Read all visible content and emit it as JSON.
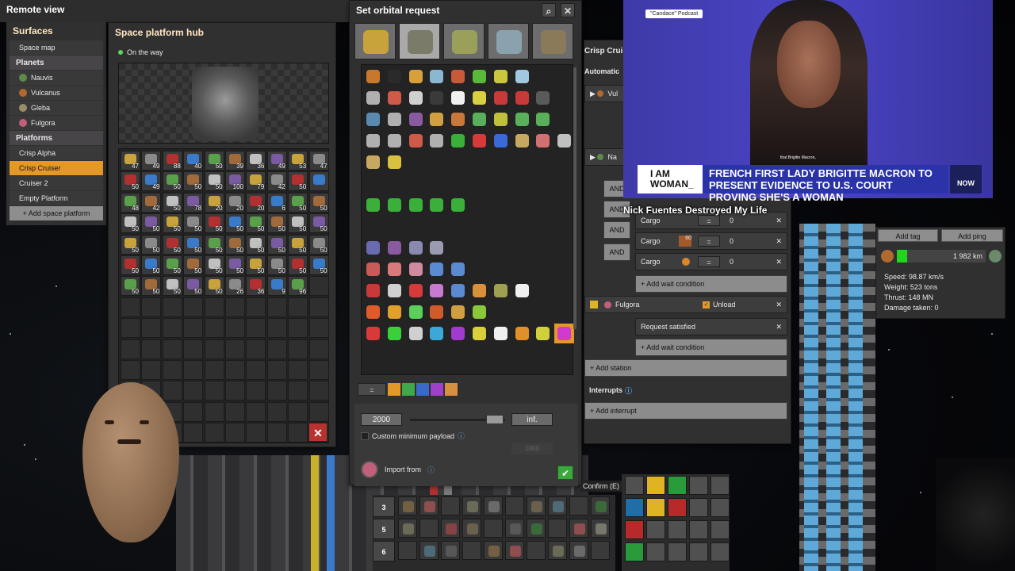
{
  "remote_view": {
    "title": "Remote view"
  },
  "surfaces": {
    "title": "Surfaces",
    "space_map": "Space map",
    "planets_heading": "Planets",
    "planets": [
      {
        "label": "Nauvis",
        "color": "#5e8a4c"
      },
      {
        "label": "Vulcanus",
        "color": "#b06a30"
      },
      {
        "label": "Gleba",
        "color": "#9a8e6a"
      },
      {
        "label": "Fulgora",
        "color": "#c0607a"
      }
    ],
    "platforms_heading": "Platforms",
    "platforms": [
      "Crisp Alpha",
      "Crisp Cruiser",
      "Cruiser 2",
      "Empty Platform"
    ],
    "selected_platform": "Crisp Cruiser",
    "add_platform": "+ Add space platform"
  },
  "hub": {
    "title": "Space platform hub",
    "status": "On the way",
    "slots": [
      "47",
      "49",
      "88",
      "40",
      "50",
      "39",
      "36",
      "49",
      "53",
      "47",
      "50",
      "49",
      "50",
      "50",
      "50",
      "100",
      "79",
      "42",
      "50",
      "",
      "48",
      "42",
      "50",
      "78",
      "20",
      "20",
      "20",
      "6",
      "50",
      "50",
      "50",
      "50",
      "50",
      "50",
      "50",
      "50",
      "50",
      "50",
      "50",
      "50",
      "50",
      "50",
      "50",
      "50",
      "50",
      "50",
      "50",
      "50",
      "50",
      "50",
      "50",
      "50",
      "50",
      "50",
      "50",
      "50",
      "50",
      "50",
      "50",
      "50",
      "50",
      "50",
      "50",
      "50",
      "50",
      "26",
      "36",
      "9",
      "96"
    ],
    "close_label": "✕"
  },
  "orbital": {
    "title": "Set orbital request",
    "value": "2000",
    "max_label": "inf.",
    "custom_min_label": "Custom minimum payload",
    "custom_min_value": "1000",
    "import_from_label": "Import from",
    "confirm_tooltip": "Confirm (E)",
    "filter_symbol": "="
  },
  "schedule": {
    "header": "Crisp Cruiser",
    "automatic": "Automatic",
    "stations": [
      "Vul",
      "Na"
    ],
    "and_labels": [
      "AND",
      "AND",
      "AND",
      "AND"
    ],
    "conditions": [
      {
        "label": "Cargo",
        "op": "=",
        "value": "0",
        "count": ""
      },
      {
        "label": "Cargo",
        "op": "=",
        "value": "0",
        "count": "60"
      },
      {
        "label": "Cargo",
        "op": "=",
        "value": "0",
        "count": ""
      }
    ],
    "add_wait": "+ Add wait condition",
    "fulgora": "Fulgora",
    "unload": "Unload",
    "request_satisfied": "Request satisfied",
    "add_wait_2": "+ Add wait condition",
    "add_station": "+ Add station",
    "interrupts": "Interrupts",
    "add_interrupt": "+ Add interrupt"
  },
  "info": {
    "add_tag": "Add tag",
    "add_ping": "Add ping",
    "distance": "1 982 km",
    "speed": "Speed: 98.87 km/s",
    "weight": "Weight: 523 tons",
    "thrust": "Thrust: 148 MN",
    "damage": "Damage taken: 0"
  },
  "video": {
    "podcast_tag": "\"Candace\" Podcast",
    "banner_left": "I AM WOMAN_",
    "banner_right": "FRENCH FIRST LADY BRIGITTE MACRON TO PRESENT EVIDENCE TO U.S. COURT PROVING SHE'S A WOMAN",
    "subtitle": "that Brigitte Macron,",
    "network": "NOW",
    "caption": "Nick Fuentes Destroyed My Life"
  },
  "hotbar": {
    "rows": [
      "3",
      "5",
      "6"
    ]
  }
}
